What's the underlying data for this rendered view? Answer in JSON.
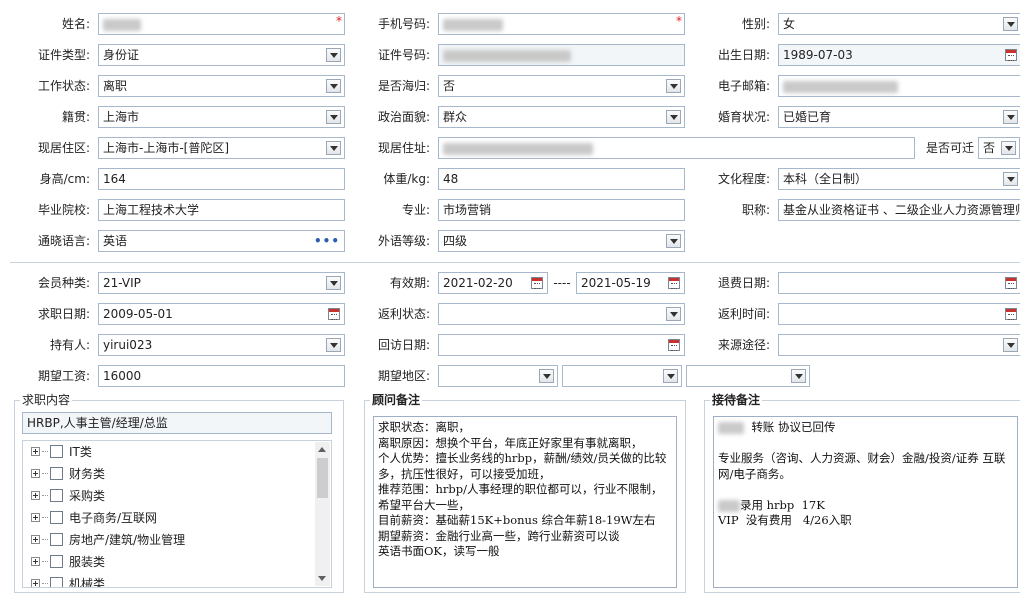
{
  "basic": {
    "name": {
      "label": "姓名:",
      "value": ""
    },
    "phone": {
      "label": "手机号码:",
      "value": ""
    },
    "gender": {
      "label": "性别:",
      "value": "女"
    },
    "id_type": {
      "label": "证件类型:",
      "value": "身份证"
    },
    "id_number": {
      "label": "证件号码:",
      "value": ""
    },
    "birth_date": {
      "label": "出生日期:",
      "value": "1989-07-03"
    },
    "work_status": {
      "label": "工作状态:",
      "value": "离职"
    },
    "overseas_return": {
      "label": "是否海归:",
      "value": "否"
    },
    "email": {
      "label": "电子邮箱:",
      "value": ""
    },
    "native_place": {
      "label": "籍贯:",
      "value": "上海市"
    },
    "political_status": {
      "label": "政治面貌:",
      "value": "群众"
    },
    "marital_status": {
      "label": "婚育状况:",
      "value": "已婚已育"
    },
    "residence_area": {
      "label": "现居住区:",
      "value": "上海市-上海市-[普陀区]"
    },
    "residence_address": {
      "label": "现居住址:",
      "value": ""
    },
    "relocate": {
      "label": "是否可迁",
      "value": "否"
    },
    "height": {
      "label": "身高/cm:",
      "value": "164"
    },
    "weight": {
      "label": "体重/kg:",
      "value": "48"
    },
    "education": {
      "label": "文化程度:",
      "value": "本科（全日制）"
    },
    "school": {
      "label": "毕业院校:",
      "value": "上海工程技术大学"
    },
    "major": {
      "label": "专业:",
      "value": "市场营销"
    },
    "title": {
      "label": "职称:",
      "value": "基金从业资格证书 、二级企业人力资源管理师"
    },
    "language": {
      "label": "通晓语言:",
      "value": "英语"
    },
    "language_level": {
      "label": "外语等级:",
      "value": "四级"
    }
  },
  "membership": {
    "member_type": {
      "label": "会员种类:",
      "value": "21-VIP"
    },
    "valid_period": {
      "label": "有效期:",
      "start": "2021-02-20",
      "separator": "----",
      "end": "2021-05-19"
    },
    "refund_date": {
      "label": "退费日期:",
      "value": ""
    },
    "job_seek_date": {
      "label": "求职日期:",
      "value": "2009-05-01"
    },
    "rebate_status": {
      "label": "返利状态:",
      "value": ""
    },
    "rebate_time": {
      "label": "返利时间:",
      "value": ""
    },
    "holder": {
      "label": "持有人:",
      "value": "yirui023"
    },
    "revisit_date": {
      "label": "回访日期:",
      "value": ""
    },
    "source": {
      "label": "来源途径:",
      "value": ""
    },
    "expected_salary": {
      "label": "期望工资:",
      "value": "16000"
    },
    "expected_region": {
      "label": "期望地区:",
      "values": [
        "",
        "",
        ""
      ]
    }
  },
  "job_content": {
    "title": "求职内容",
    "selected": "HRBP,人事主管/经理/总监",
    "tree": [
      {
        "label": "IT类"
      },
      {
        "label": "财务类"
      },
      {
        "label": "采购类"
      },
      {
        "label": "电子商务/互联网"
      },
      {
        "label": "房地产/建筑/物业管理"
      },
      {
        "label": "服装类"
      },
      {
        "label": "机械类"
      }
    ]
  },
  "advisor_notes": {
    "title": "顾问备注",
    "text": "求职状态：离职，\n离职原因：想换个平台，年底正好家里有事就离职，\n个人优势：擅长业务线的hrbp，薪酬/绩效/员关做的比较多，抗压性很好，可以接受加班，\n推荐范围：hrbp/人事经理的职位都可以，行业不限制，希望平台大一些，\n目前薪资：基础薪15K+bonus 综合年薪18-19W左右\n期望薪资：金融行业高一些，跨行业薪资可以谈\n英语书面OK，读写一般"
  },
  "reception_notes": {
    "title": "接待备注",
    "line1": "转账 协议已回传",
    "line2": "专业服务（咨询、人力资源、财会）金融/投资/证券 互联网/电子商务。",
    "line3": "录用 hrbp  17K",
    "line4": "VIP  没有费用   4/26入职"
  },
  "colors": {
    "required": "#e02020",
    "border": "#a8b8cc",
    "accent": "#2a5db0"
  }
}
